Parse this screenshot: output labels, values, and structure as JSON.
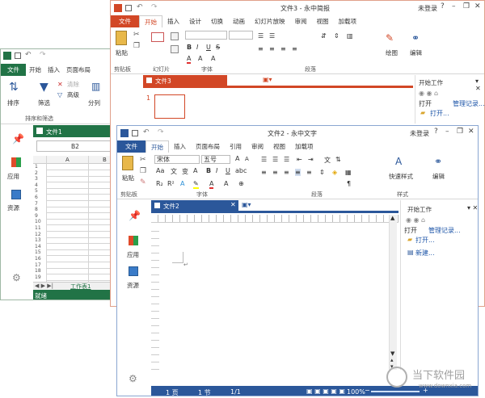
{
  "colors": {
    "presentation": "#d24726",
    "document": "#2b579a",
    "spreadsheet": "#217346"
  },
  "sidebar": {
    "apps_label": "应用",
    "resources_label": "资源"
  },
  "presentation": {
    "title": "文件3 - 永中简报",
    "user": "未登录",
    "tabs": [
      "文件",
      "开始",
      "插入",
      "设计",
      "切换",
      "动画",
      "幻灯片放映",
      "审阅",
      "视图",
      "加载项"
    ],
    "groups": [
      "剪贴板",
      "幻灯片",
      "字体",
      "段落"
    ],
    "paste_label": "粘贴",
    "draw_label": "绘图",
    "edit_label": "编辑",
    "doc_tab": "文件3",
    "slide_number": "1",
    "taskpane": {
      "title": "开始工作",
      "open": "打开",
      "manage": "管理记录...",
      "open_link": "打开..."
    }
  },
  "spreadsheet": {
    "tabs": [
      "文件",
      "开始",
      "插入",
      "页面布局"
    ],
    "sort_label": "排序",
    "filter_label": "筛选",
    "clear_label": "清除",
    "advanced_label": "高级",
    "split_label": "分列",
    "group_label": "排序和筛选",
    "doc_tab": "文件1",
    "cell_ref": "B2",
    "columns": [
      "A",
      "B"
    ],
    "rows": [
      "1",
      "2",
      "3",
      "4",
      "5",
      "6",
      "7",
      "8",
      "9",
      "10",
      "11",
      "12",
      "13",
      "14",
      "15",
      "16",
      "17",
      "18",
      "19"
    ],
    "sheet_tab": "工作表1",
    "status": "就绪"
  },
  "document": {
    "title": "文件2 - 永中文字",
    "user": "未登录",
    "tabs": [
      "文件",
      "开始",
      "插入",
      "页面布局",
      "引用",
      "审阅",
      "视图",
      "加载项"
    ],
    "font_name": "宋体",
    "font_size": "五号",
    "groups": [
      "剪贴板",
      "字体",
      "段落",
      "样式"
    ],
    "paste_label": "粘贴",
    "styles_label": "快速样式",
    "edit_label": "编辑",
    "doc_tab": "文件2",
    "taskpane": {
      "title": "开始工作",
      "open": "打开",
      "manage": "管理记录...",
      "open_link": "打开...",
      "new_link": "新建..."
    },
    "status": {
      "page": "1 页",
      "section": "1 节",
      "pages": "1/1",
      "zoom": "100%"
    }
  },
  "watermark": {
    "text": "当下软件园",
    "url": "www.downxia.com"
  }
}
